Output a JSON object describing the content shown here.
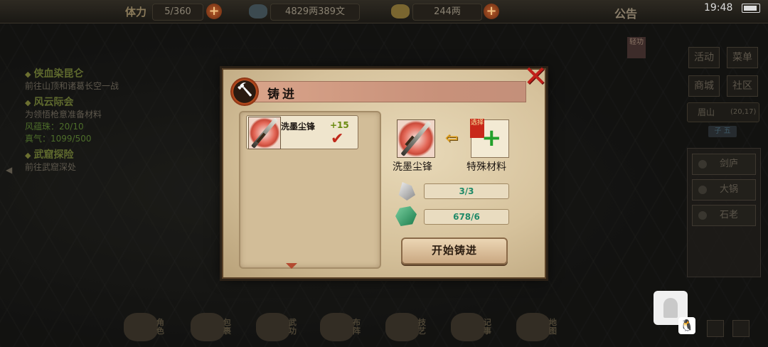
{
  "topbar": {
    "stamina_label": "体力",
    "stamina_value": "5/360",
    "money_value": "4829两389文",
    "ingot_value": "244两",
    "notice": "公告",
    "time": "19:48"
  },
  "quests": [
    {
      "title": "侠血染昆仑",
      "desc": "前往山顶和诸葛长空一战"
    },
    {
      "title": "风云际会",
      "desc": "为领悟枪意准备材料",
      "extra": [
        "风蕴珠：20/10",
        "真气：1099/500"
      ]
    },
    {
      "title": "武窟探险",
      "desc": "前往武窟深处"
    }
  ],
  "right_menu": {
    "qingzhuang": "轻功",
    "buttons": [
      "活动",
      "菜单",
      "商城",
      "社区"
    ],
    "location_name": "眉山",
    "location_coord": "(20,17)",
    "time_badge": "子 五",
    "npcs": [
      "剑庐",
      "大锅",
      "石老"
    ]
  },
  "bottom_bar": [
    "角色",
    "包裹",
    "武功",
    "布阵",
    "技艺",
    "记事",
    "地图"
  ],
  "dialog": {
    "title": "铸进",
    "list_items": [
      {
        "name": "洗墨尘锋",
        "level": "+15"
      }
    ],
    "target_label": "洗墨尘锋",
    "ribbon": "选择",
    "material_label": "特殊材料",
    "material1_count": "3/3",
    "material2_count": "678/6",
    "start_button": "开始铸进"
  },
  "colors": {
    "accent_red": "#c0201a",
    "count_green": "#1f8a68",
    "level_green": "#6a8a10"
  }
}
